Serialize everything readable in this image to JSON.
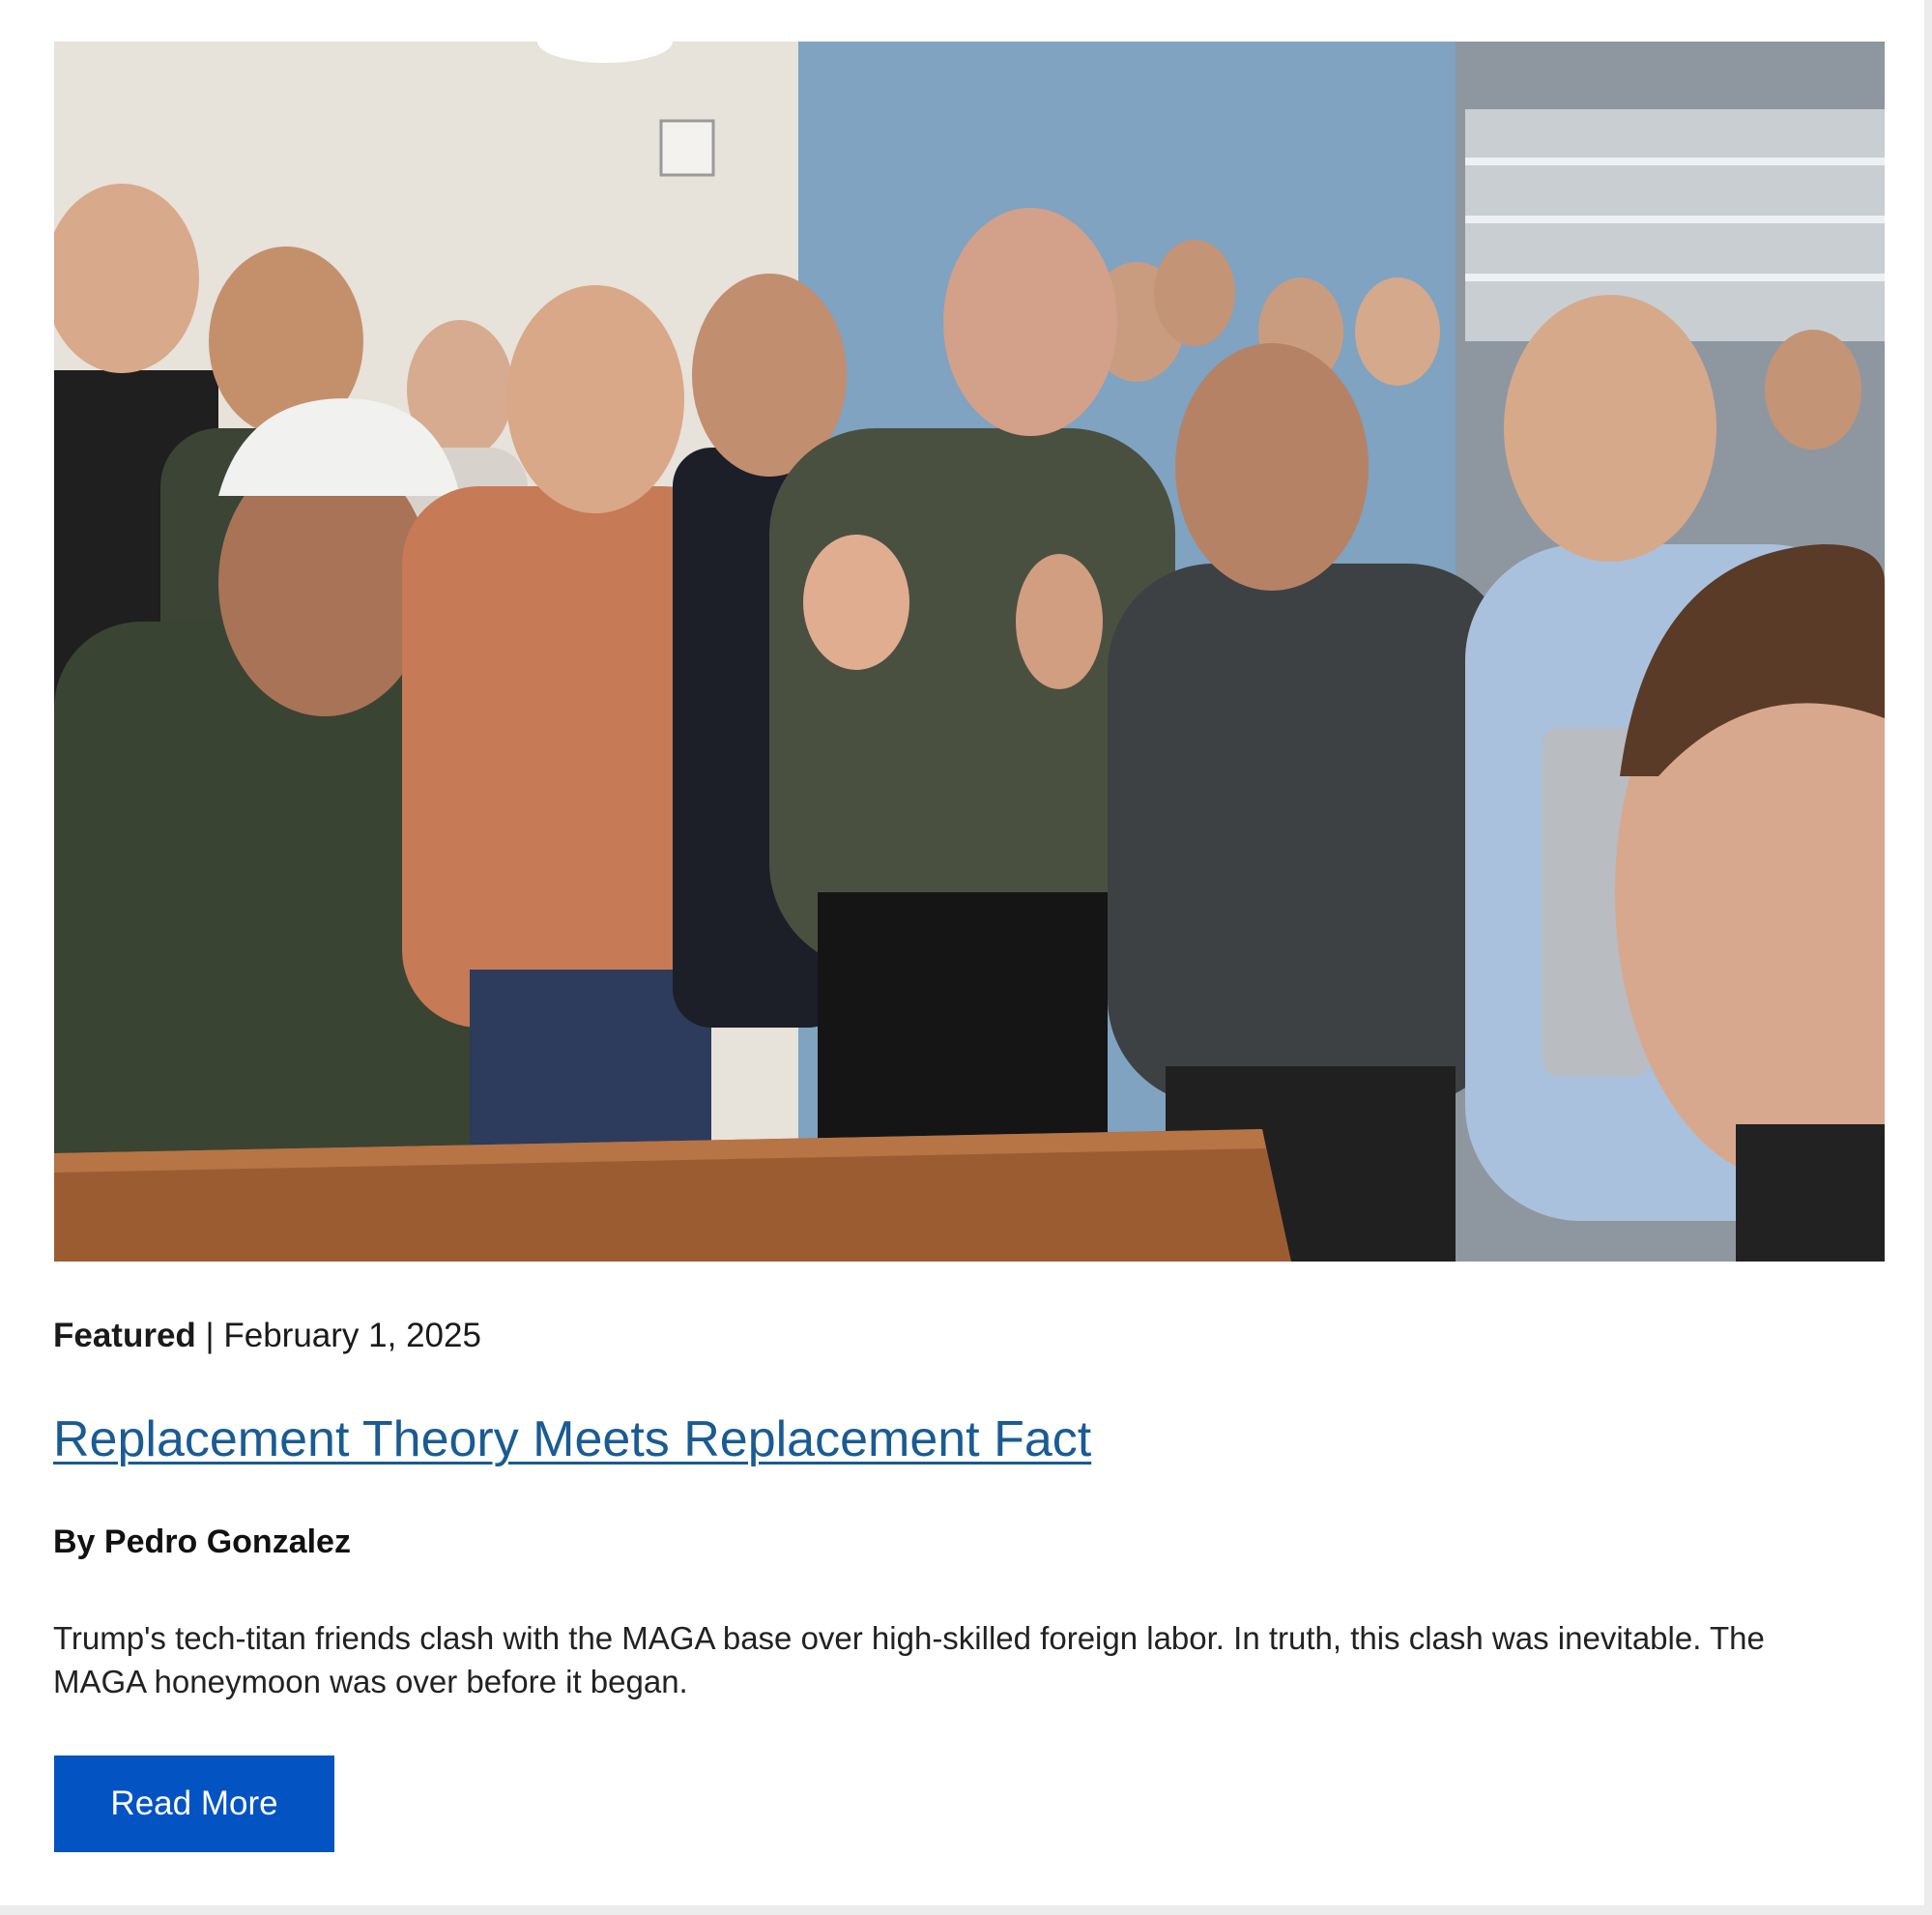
{
  "article": {
    "category": "Featured",
    "separator": "|",
    "date": "February 1, 2025",
    "title": "Replacement Theory Meets Replacement Fact",
    "byline": "By Pedro Gonzalez",
    "summary": "Trump's tech-titan friends clash with the MAGA base over high-skilled foreign labor. In truth, this clash was inevitable. The MAGA honeymoon was over before it began.",
    "read_more_label": "Read More",
    "colors": {
      "link": "#1a5b93",
      "button": "#0353c3"
    }
  }
}
